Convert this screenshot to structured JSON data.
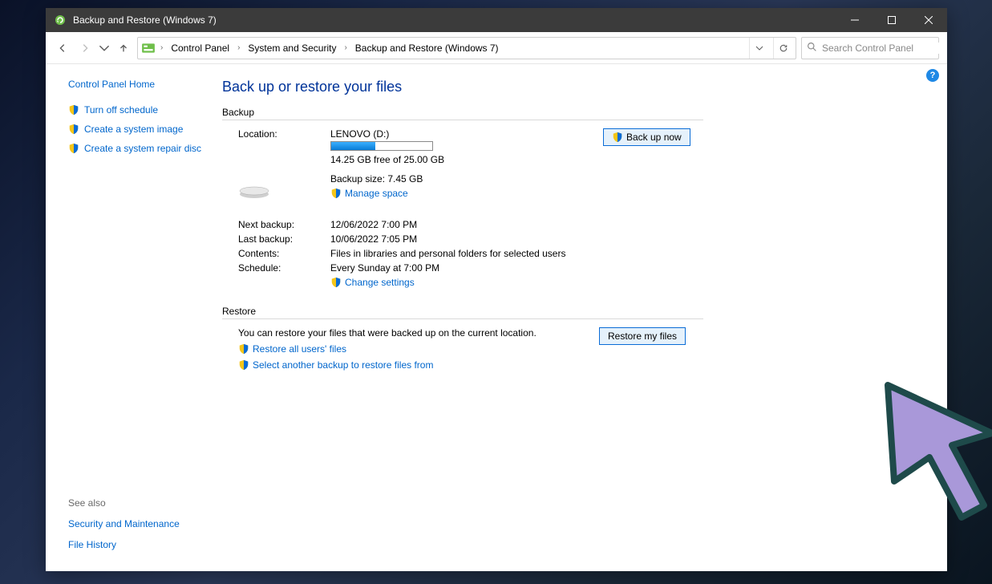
{
  "titlebar": {
    "title": "Backup and Restore (Windows 7)"
  },
  "breadcrumbs": {
    "items": [
      "Control Panel",
      "System and Security",
      "Backup and Restore (Windows 7)"
    ]
  },
  "search": {
    "placeholder": "Search Control Panel"
  },
  "sidebar": {
    "home": "Control Panel Home",
    "items": [
      {
        "label": "Turn off schedule"
      },
      {
        "label": "Create a system image"
      },
      {
        "label": "Create a system repair disc"
      }
    ],
    "see_also_hdr": "See also",
    "see_also": [
      {
        "label": "Security and Maintenance"
      },
      {
        "label": "File History"
      }
    ]
  },
  "main": {
    "page_title": "Back up or restore your files",
    "backup": {
      "hdr": "Backup",
      "location_lbl": "Location:",
      "location_val": "LENOVO (D:)",
      "free_text": "14.25 GB free of 25.00 GB",
      "size_text": "Backup size: 7.45 GB",
      "manage_space": "Manage space",
      "backup_now_btn": "Back up now",
      "next_lbl": "Next backup:",
      "next_val": "12/06/2022 7:00 PM",
      "last_lbl": "Last backup:",
      "last_val": "10/06/2022 7:05 PM",
      "contents_lbl": "Contents:",
      "contents_val": "Files in libraries and personal folders for selected users",
      "schedule_lbl": "Schedule:",
      "schedule_val": "Every Sunday at 7:00 PM",
      "change_settings": "Change settings"
    },
    "restore": {
      "hdr": "Restore",
      "text": "You can restore your files that were backed up on the current location.",
      "restore_all": "Restore all users' files",
      "select_another": "Select another backup to restore files from",
      "restore_btn": "Restore my files"
    }
  }
}
